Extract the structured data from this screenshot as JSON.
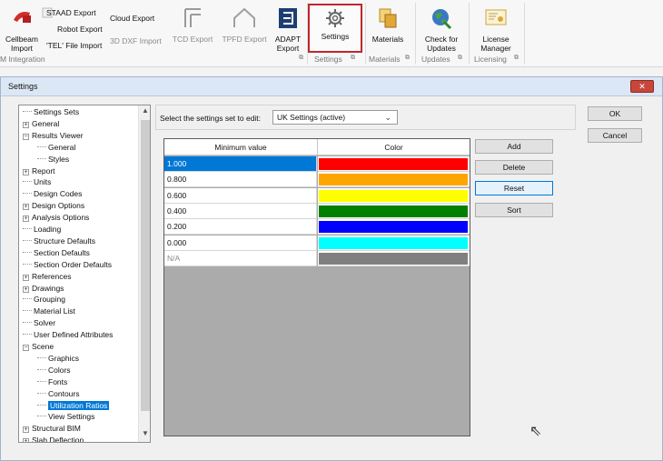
{
  "ribbon": {
    "cellbeam_import": "Cellbeam\nImport",
    "staad_export": "STAAD Export",
    "robot_export": "Robot Export",
    "tel_import": "'TEL' File Import",
    "cloud_export": "Cloud Export",
    "dxf_import": "3D DXF Import",
    "tcd_export": "TCD Export",
    "tpfd_export": "TPFD Export",
    "adapt_export": "ADAPT\nExport",
    "settings": "Settings",
    "materials": "Materials",
    "check_updates": "Check for\nUpdates",
    "license_manager": "License\nManager",
    "groups": {
      "integration": "M Integration",
      "settings": "Settings",
      "materials": "Materials",
      "updates": "Updates",
      "licensing": "Licensing"
    },
    "launcher_glyph": "⧉"
  },
  "dialog": {
    "title": "Settings",
    "close_glyph": "✕"
  },
  "tree": {
    "items": [
      {
        "label": "Settings Sets",
        "indent": 0,
        "exp": ""
      },
      {
        "label": "General",
        "indent": 0,
        "exp": "+"
      },
      {
        "label": "Results Viewer",
        "indent": 0,
        "exp": "−"
      },
      {
        "label": "General",
        "indent": 1,
        "exp": ""
      },
      {
        "label": "Styles",
        "indent": 1,
        "exp": ""
      },
      {
        "label": "Report",
        "indent": 0,
        "exp": "+"
      },
      {
        "label": "Units",
        "indent": 0,
        "exp": ""
      },
      {
        "label": "Design Codes",
        "indent": 0,
        "exp": ""
      },
      {
        "label": "Design Options",
        "indent": 0,
        "exp": "+"
      },
      {
        "label": "Analysis Options",
        "indent": 0,
        "exp": "+"
      },
      {
        "label": "Loading",
        "indent": 0,
        "exp": ""
      },
      {
        "label": "Structure Defaults",
        "indent": 0,
        "exp": ""
      },
      {
        "label": "Section Defaults",
        "indent": 0,
        "exp": ""
      },
      {
        "label": "Section Order Defaults",
        "indent": 0,
        "exp": ""
      },
      {
        "label": "References",
        "indent": 0,
        "exp": "+"
      },
      {
        "label": "Drawings",
        "indent": 0,
        "exp": "+"
      },
      {
        "label": "Grouping",
        "indent": 0,
        "exp": ""
      },
      {
        "label": "Material List",
        "indent": 0,
        "exp": ""
      },
      {
        "label": "Solver",
        "indent": 0,
        "exp": ""
      },
      {
        "label": "User Defined Attributes",
        "indent": 0,
        "exp": ""
      },
      {
        "label": "Scene",
        "indent": 0,
        "exp": "−"
      },
      {
        "label": "Graphics",
        "indent": 1,
        "exp": ""
      },
      {
        "label": "Colors",
        "indent": 1,
        "exp": ""
      },
      {
        "label": "Fonts",
        "indent": 1,
        "exp": ""
      },
      {
        "label": "Contours",
        "indent": 1,
        "exp": ""
      },
      {
        "label": "Utilization Ratios",
        "indent": 1,
        "exp": "",
        "selected": true
      },
      {
        "label": "View Settings",
        "indent": 1,
        "exp": ""
      },
      {
        "label": "Structural BIM",
        "indent": 0,
        "exp": "+"
      },
      {
        "label": "Slab Deflection",
        "indent": 0,
        "exp": "+"
      }
    ],
    "scroll_up": "▲",
    "scroll_down": "▼"
  },
  "settings_set": {
    "label": "Select the settings set to edit:",
    "value": "UK Settings (active)",
    "chevron": "⌄"
  },
  "table": {
    "headers": [
      "Minimum value",
      "Color"
    ],
    "rows": [
      {
        "value": "1.000",
        "color": "#ff0000"
      },
      {
        "value": "0.800",
        "color": "#ffa500"
      },
      {
        "value": "0.600",
        "color": "#ffff00"
      },
      {
        "value": "0.400",
        "color": "#008000"
      },
      {
        "value": "0.200",
        "color": "#0000ff"
      },
      {
        "value": "0.000",
        "color": "#00ffff"
      },
      {
        "value": "N/A",
        "color": "#808080"
      }
    ]
  },
  "buttons": {
    "ok": "OK",
    "cancel": "Cancel",
    "add": "Add",
    "delete": "Delete",
    "reset": "Reset",
    "sort": "Sort"
  },
  "colors": {
    "highlight_red": "#c0262d",
    "selection_blue": "#0078d7"
  }
}
